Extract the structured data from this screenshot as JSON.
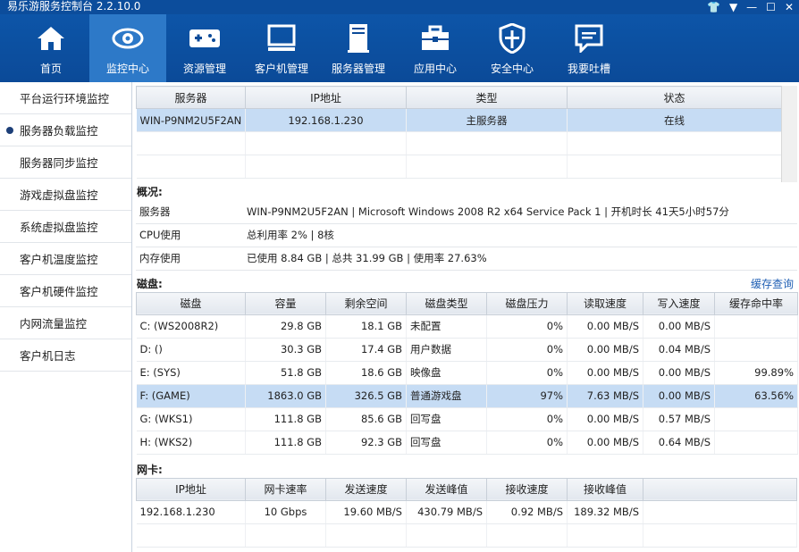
{
  "window": {
    "title": "易乐游服务控制台 2.2.10.0"
  },
  "toolbar": [
    {
      "label": "首页",
      "icon": "home-icon"
    },
    {
      "label": "监控中心",
      "icon": "eye-icon",
      "active": true
    },
    {
      "label": "资源管理",
      "icon": "gamepad-icon"
    },
    {
      "label": "客户机管理",
      "icon": "monitor-icon"
    },
    {
      "label": "服务器管理",
      "icon": "server-icon"
    },
    {
      "label": "应用中心",
      "icon": "toolbox-icon"
    },
    {
      "label": "安全中心",
      "icon": "shield-icon"
    },
    {
      "label": "我要吐槽",
      "icon": "comment-icon"
    }
  ],
  "sidebar": [
    {
      "label": "平台运行环境监控"
    },
    {
      "label": "服务器负载监控",
      "active": true
    },
    {
      "label": "服务器同步监控"
    },
    {
      "label": "游戏虚拟盘监控"
    },
    {
      "label": "系统虚拟盘监控"
    },
    {
      "label": "客户机温度监控"
    },
    {
      "label": "客户机硬件监控"
    },
    {
      "label": "内网流量监控"
    },
    {
      "label": "客户机日志"
    }
  ],
  "servers": {
    "headers": [
      "服务器",
      "IP地址",
      "类型",
      "状态"
    ],
    "rows": [
      [
        "WIN-P9NM2U5F2AN",
        "192.168.1.230",
        "主服务器",
        "在线"
      ]
    ]
  },
  "overview": {
    "title": "概况:",
    "rows": [
      {
        "key": "服务器",
        "value": "WIN-P9NM2U5F2AN | Microsoft Windows 2008 R2 x64 Service Pack 1 | 开机时长 41天5小时57分"
      },
      {
        "key": "CPU使用",
        "value": "总利用率 2% | 8核"
      },
      {
        "key": "内存使用",
        "value": "已使用 8.84 GB | 总共 31.99 GB | 使用率 27.63%"
      }
    ]
  },
  "disk": {
    "title": "磁盘:",
    "link": "缓存查询",
    "headers": [
      "磁盘",
      "容量",
      "剩余空间",
      "磁盘类型",
      "磁盘压力",
      "读取速度",
      "写入速度",
      "缓存命中率"
    ],
    "rows": [
      [
        "C: (WS2008R2)",
        "29.8  GB",
        "18.1  GB",
        "未配置",
        "0%",
        "0.00  MB/S",
        "0.00  MB/S",
        ""
      ],
      [
        "D: ()",
        "30.3  GB",
        "17.4  GB",
        "用户数据",
        "0%",
        "0.00  MB/S",
        "0.04  MB/S",
        ""
      ],
      [
        "E: (SYS)",
        "51.8  GB",
        "18.6  GB",
        "映像盘",
        "0%",
        "0.00  MB/S",
        "0.00  MB/S",
        "99.89%"
      ],
      [
        "F: (GAME)",
        "1863.0  GB",
        "326.5  GB",
        "普通游戏盘",
        "97%",
        "7.63  MB/S",
        "0.00  MB/S",
        "63.56%"
      ],
      [
        "G: (WKS1)",
        "111.8  GB",
        "85.6  GB",
        "回写盘",
        "0%",
        "0.00  MB/S",
        "0.57  MB/S",
        ""
      ],
      [
        "H: (WKS2)",
        "111.8  GB",
        "92.3  GB",
        "回写盘",
        "0%",
        "0.00  MB/S",
        "0.64  MB/S",
        ""
      ]
    ],
    "selected_row": 3
  },
  "nic": {
    "title": "网卡:",
    "headers": [
      "IP地址",
      "网卡速率",
      "发送速度",
      "发送峰值",
      "接收速度",
      "接收峰值"
    ],
    "rows": [
      [
        "192.168.1.230",
        "10 Gbps",
        "19.60  MB/S",
        "430.79  MB/S",
        "0.92  MB/S",
        "189.32  MB/S"
      ]
    ]
  }
}
